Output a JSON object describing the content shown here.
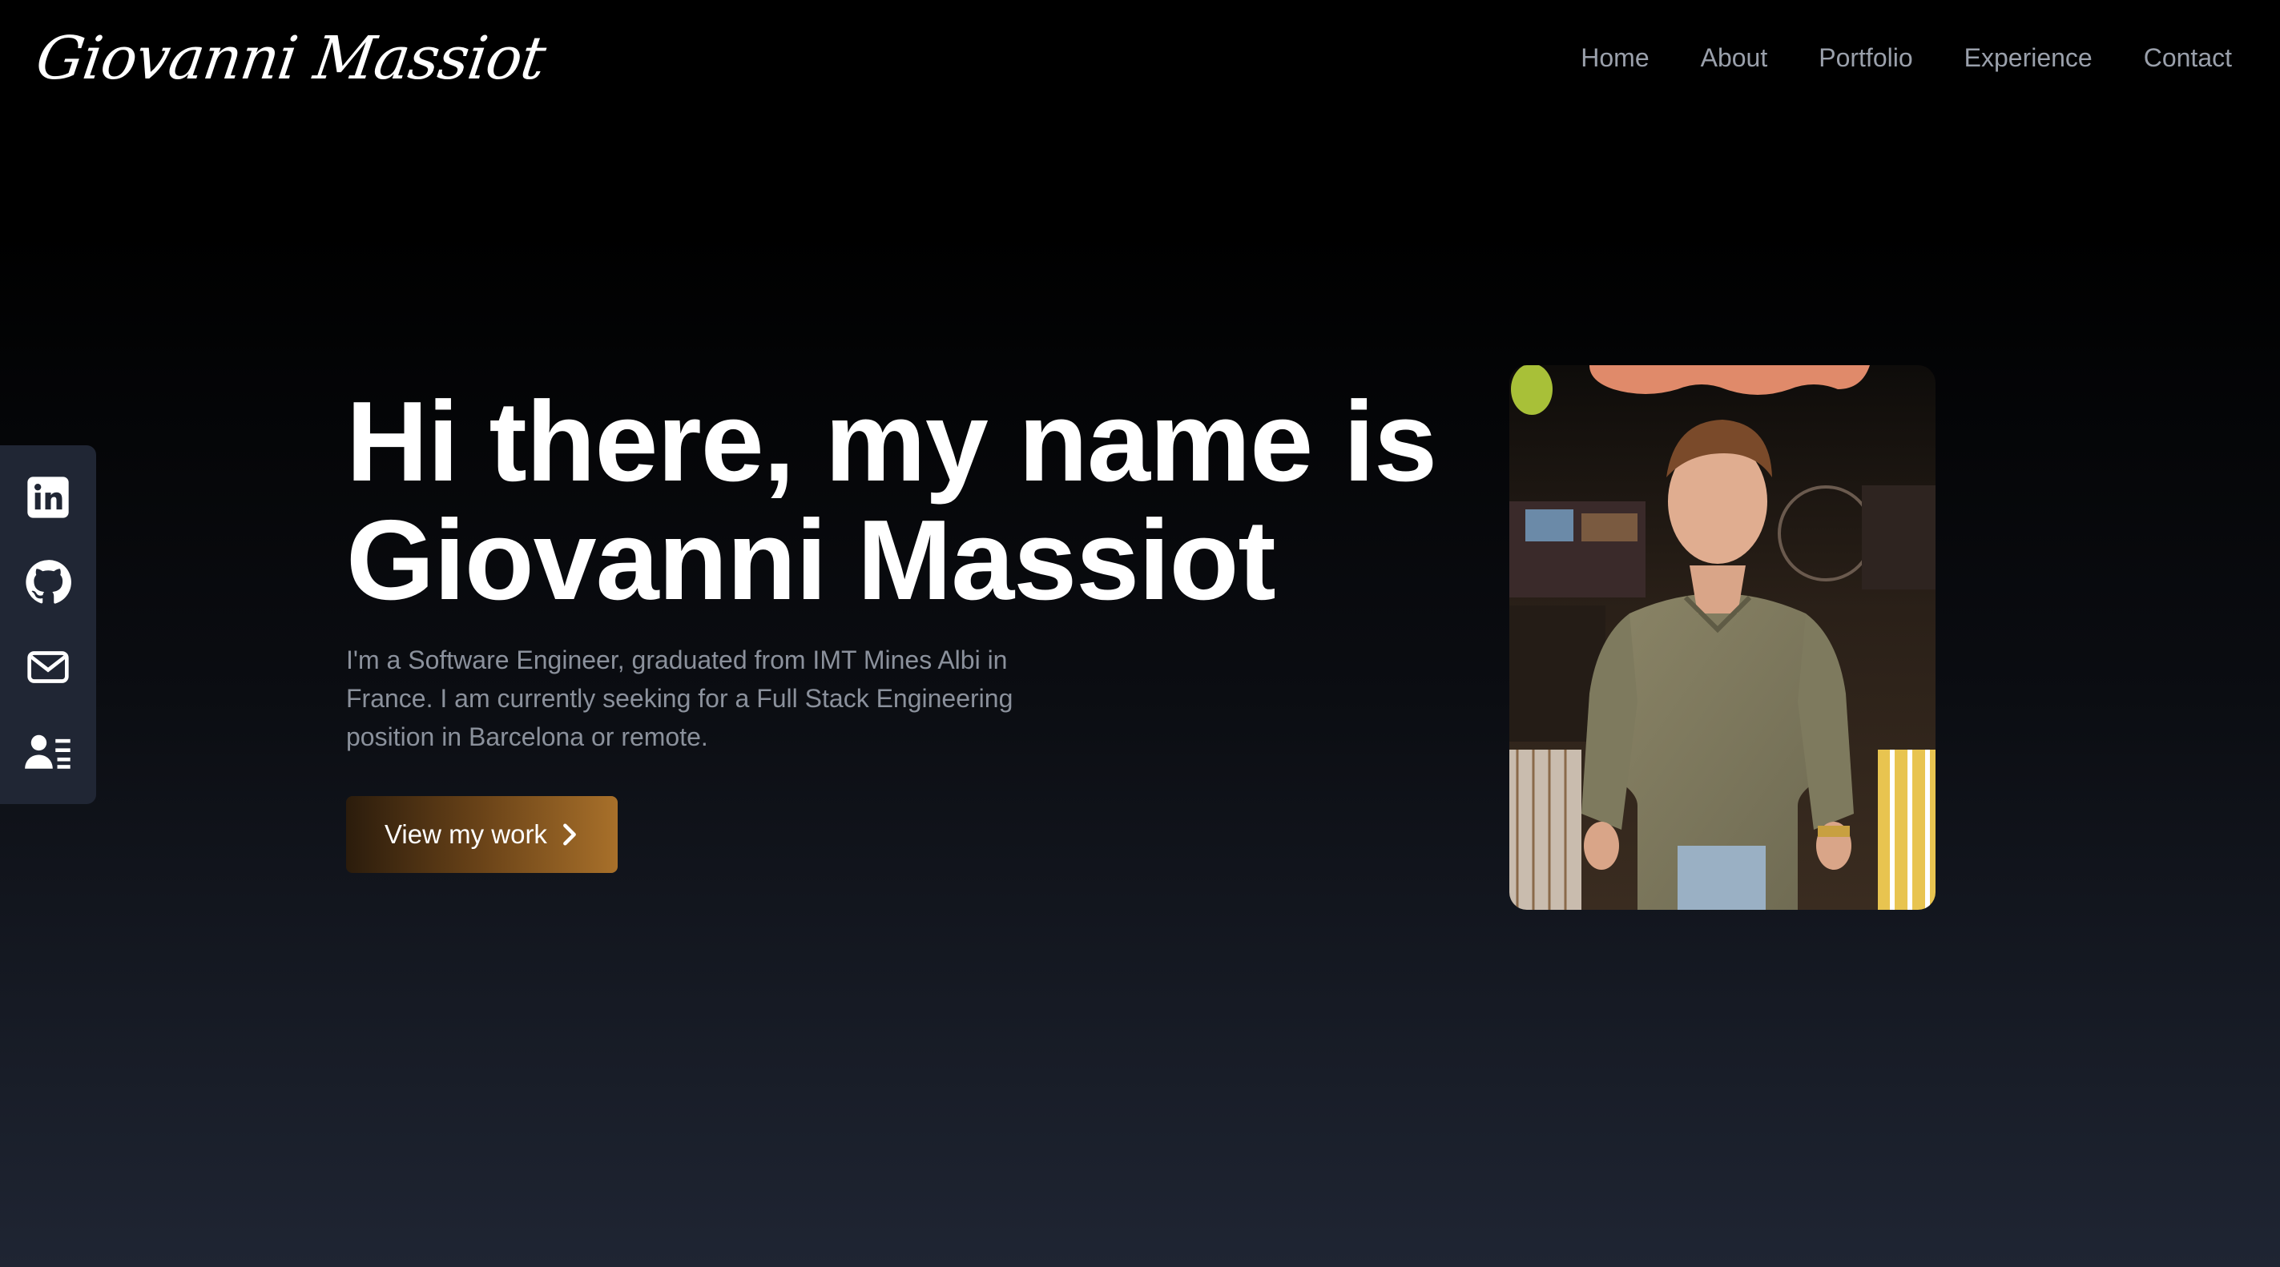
{
  "header": {
    "logo_text": "Giovanni Massiot",
    "nav": [
      "Home",
      "About",
      "Portfolio",
      "Experience",
      "Contact"
    ]
  },
  "social": {
    "icons": [
      "linkedin-icon",
      "github-icon",
      "mail-icon",
      "resume-icon"
    ]
  },
  "hero": {
    "title_line1": "Hi there, my name is",
    "title_line2": "Giovanni Massiot",
    "description": "I'm a Software Engineer, graduated from IMT Mines Albi in France. I am currently seeking for a Full Stack Engineering position in Barcelona or remote.",
    "cta_label": "View my work"
  },
  "colors": {
    "accent_gold": "#a8702a",
    "nav_text": "#9aa0ab",
    "sidebar_bg": "#202634"
  }
}
